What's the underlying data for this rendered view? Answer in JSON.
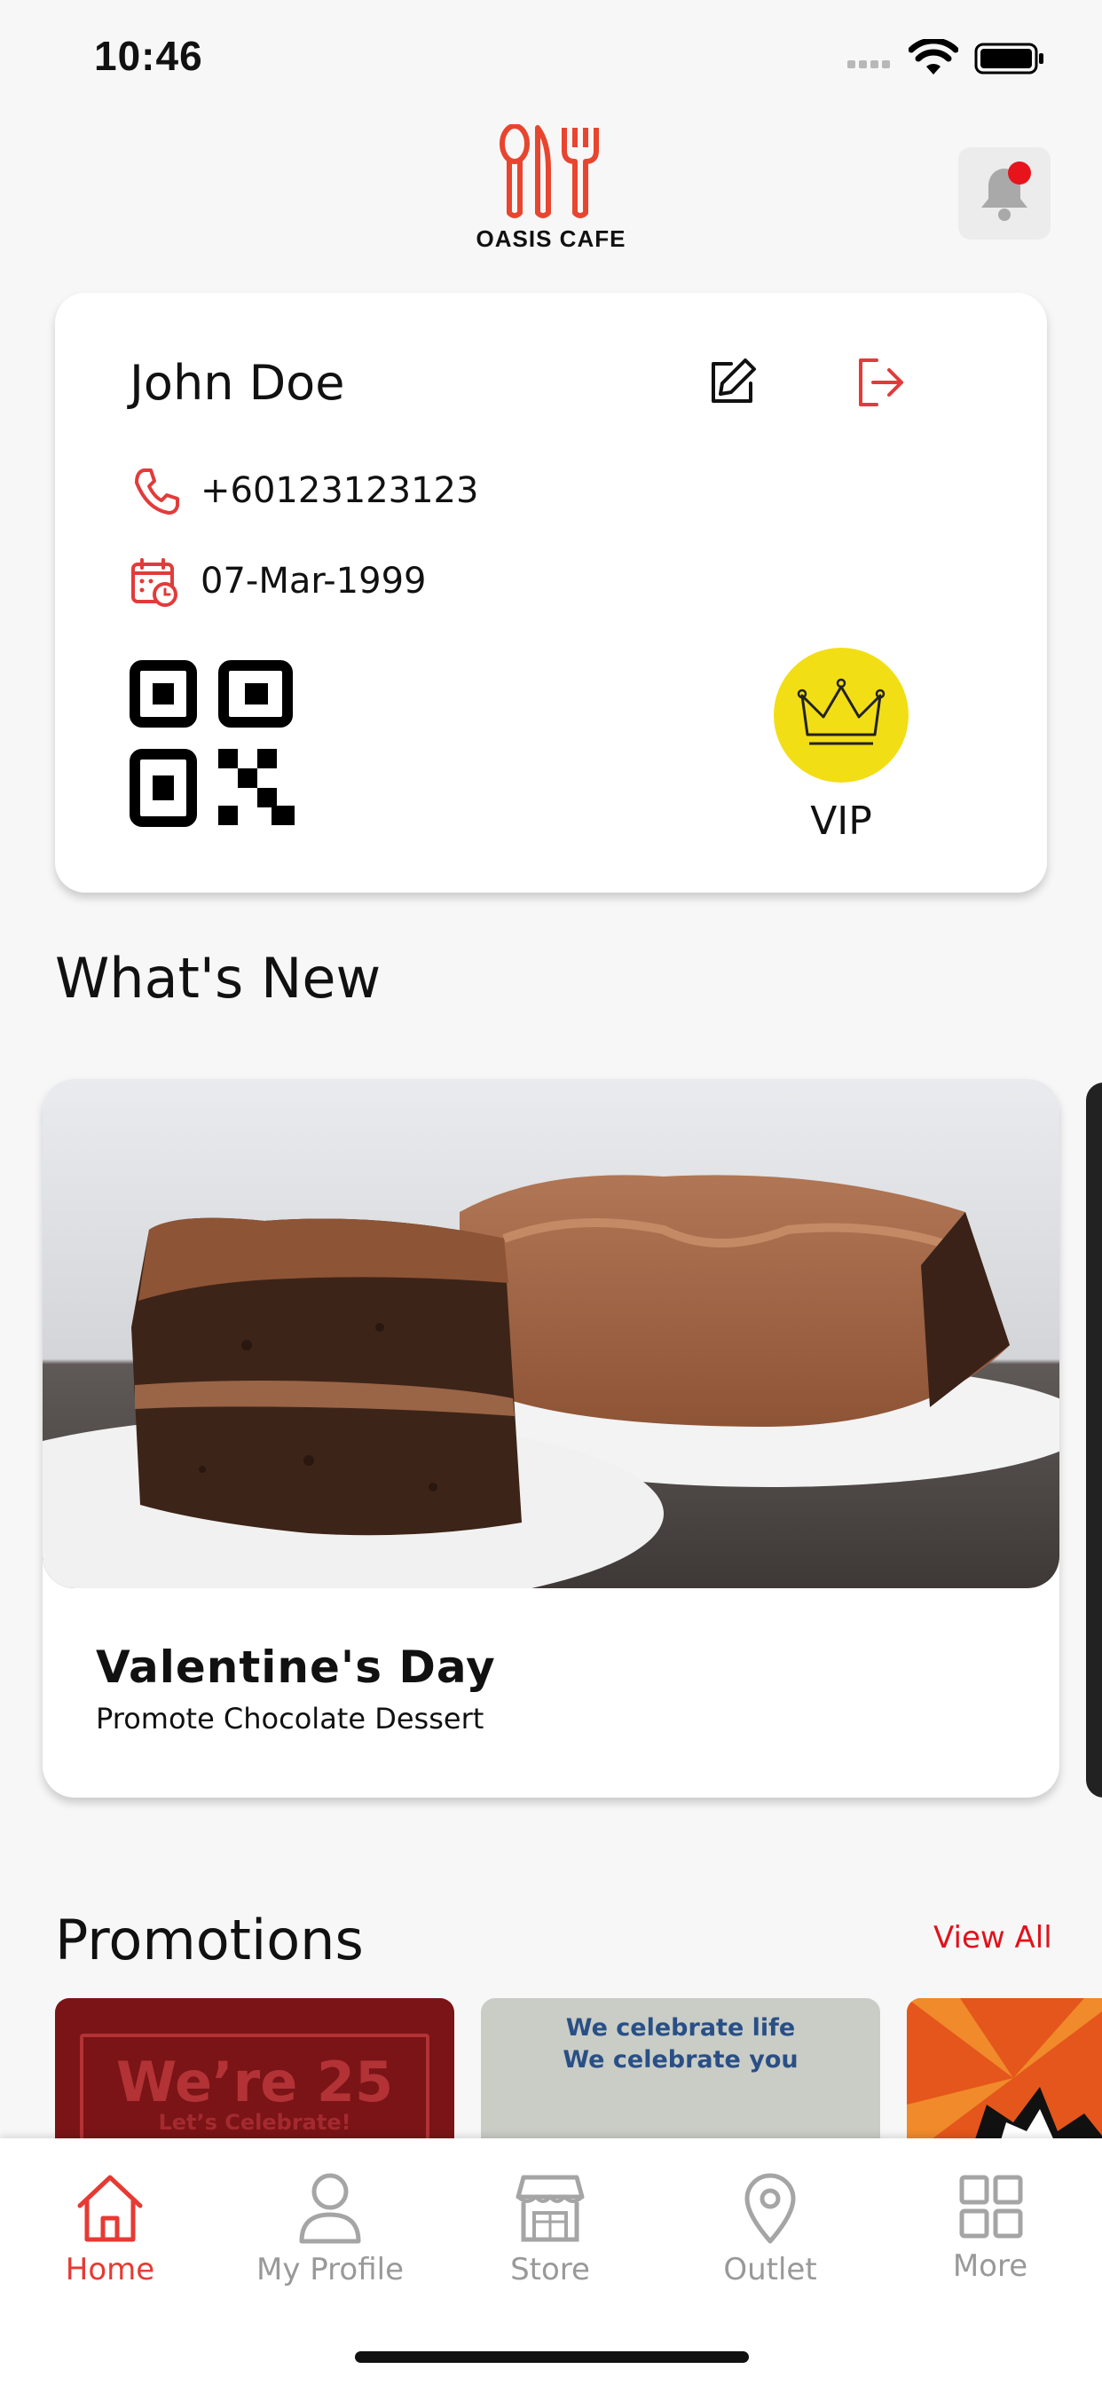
{
  "status_bar": {
    "time": "10:46"
  },
  "header": {
    "brand": "OASIS CAFE"
  },
  "profile": {
    "name": "John Doe",
    "phone": "+60123123123",
    "dob": "07-Mar-1999",
    "tier": "VIP"
  },
  "whats_new": {
    "title": "What's New",
    "items": [
      {
        "title": "Valentine's Day",
        "subtitle": "Promote Chocolate Dessert"
      }
    ]
  },
  "promotions": {
    "title": "Promotions",
    "view_all": "View All",
    "items": [
      {
        "line1": "We’re 25",
        "line2": "Let’s Celebrate!"
      },
      {
        "line1": "We celebrate life",
        "line2": "We celebrate you"
      }
    ]
  },
  "nav": {
    "items": [
      {
        "label": "Home",
        "icon": "home-icon",
        "active": true
      },
      {
        "label": "My Profile",
        "icon": "user-icon",
        "active": false
      },
      {
        "label": "Store",
        "icon": "store-icon",
        "active": false
      },
      {
        "label": "Outlet",
        "icon": "location-pin-icon",
        "active": false
      },
      {
        "label": "More",
        "icon": "grid-icon",
        "active": false
      }
    ]
  },
  "colors": {
    "accent": "#e0121b",
    "vip": "#f2de14",
    "background": "#f7f7f7"
  }
}
